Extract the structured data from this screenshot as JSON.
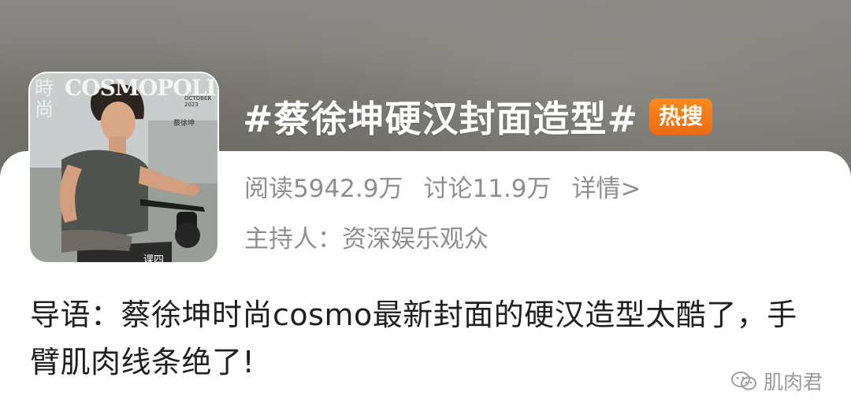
{
  "topic": {
    "title": "#蔡徐坤硬汉封面造型#",
    "badge": "热搜"
  },
  "stats": {
    "reads": "阅读5942.9万",
    "discussions": "讨论11.9万",
    "details_link": "详情>"
  },
  "host": "主持人：资深娱乐观众",
  "intro": "导语：蔡徐坤时尚cosmo最新封面的硬汉造型太酷了，手臂肌肉线条绝了!",
  "cover": {
    "masthead": "COSMOPOLITAN",
    "side_text": "時尚",
    "month": "OCTOBER 2023",
    "name": "蔡徐坤",
    "bottom_text": "课四"
  },
  "watermark": {
    "text": "肌肉君",
    "icon": "wechat-icon"
  },
  "colors": {
    "badge": "#f07a16",
    "secondary_text": "#8e8e8e",
    "body_text": "#1f1f1f"
  }
}
